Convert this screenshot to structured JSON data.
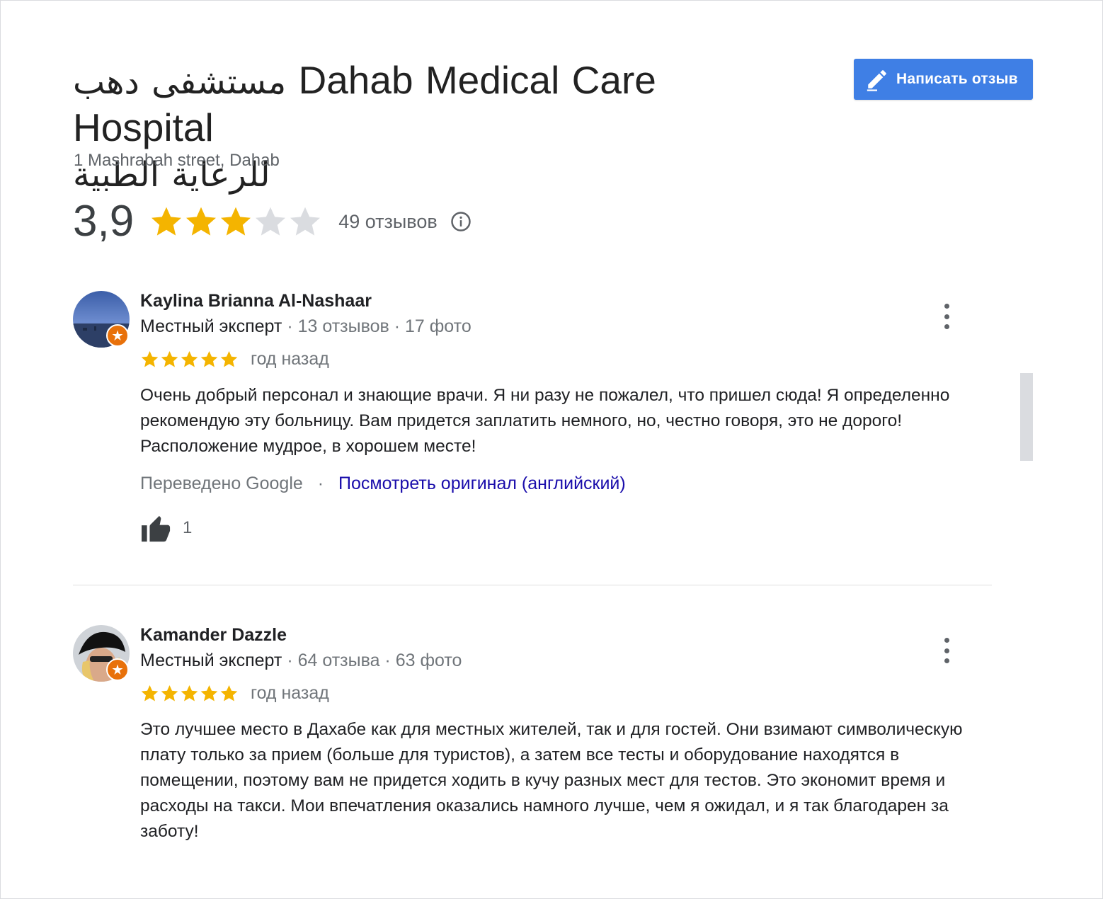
{
  "header": {
    "title_ar_1": "مستشفى دهب",
    "title_en": "Dahab Medical Care Hospital",
    "title_ar_2": "للرعاية الطبية",
    "address": "1 Mashrabah street, Dahab",
    "write_review_label": "Написать отзыв"
  },
  "summary": {
    "rating_text": "3,9",
    "rating_value": 3.9,
    "max_stars": 5,
    "review_count_label": "49 отзывов"
  },
  "colors": {
    "star_filled": "#f4b400",
    "star_empty": "#dadce0",
    "accent_button": "#3f7fe5",
    "link": "#1a0dab",
    "badge": "#e8710a"
  },
  "icons": {
    "write": "pencil-icon",
    "info": "info-icon",
    "more": "more-vert-icon",
    "like": "thumbs-up-icon",
    "badge": "local-guide-badge-icon"
  },
  "reviews": [
    {
      "name": "Kaylina Brianna Al-Nashaar",
      "badge_label": "Местный эксперт",
      "stats": " · 13 отзывов · 17 фото",
      "stars": 5,
      "time": "год назад",
      "text": "Очень добрый персонал и знающие врачи. Я ни разу не пожалел, что пришел сюда! Я определенно рекомендую эту больницу. Вам придется заплатить немного, но, честно говоря, это не дорого! Расположение мудрое, в хорошем месте!",
      "translated_label": "Переведено Google",
      "translated_sep": "·",
      "original_link": "Посмотреть оригинал (английский)",
      "likes": "1"
    },
    {
      "name": "Kamander Dazzle",
      "badge_label": "Местный эксперт",
      "stats": " · 64 отзыва · 63 фото",
      "stars": 5,
      "time": "год назад",
      "text": "Это лучшее место в Дахабе как для местных жителей, так и для гостей. Они взимают символическую плату только за прием (больше для туристов), а затем все тесты и оборудование находятся в помещении, поэтому вам не придется ходить в кучу разных мест для тестов. Это экономит время и расходы на такси. Мои впечатления оказались намного лучше, чем я ожидал, и я так благодарен за заботу!"
    }
  ]
}
